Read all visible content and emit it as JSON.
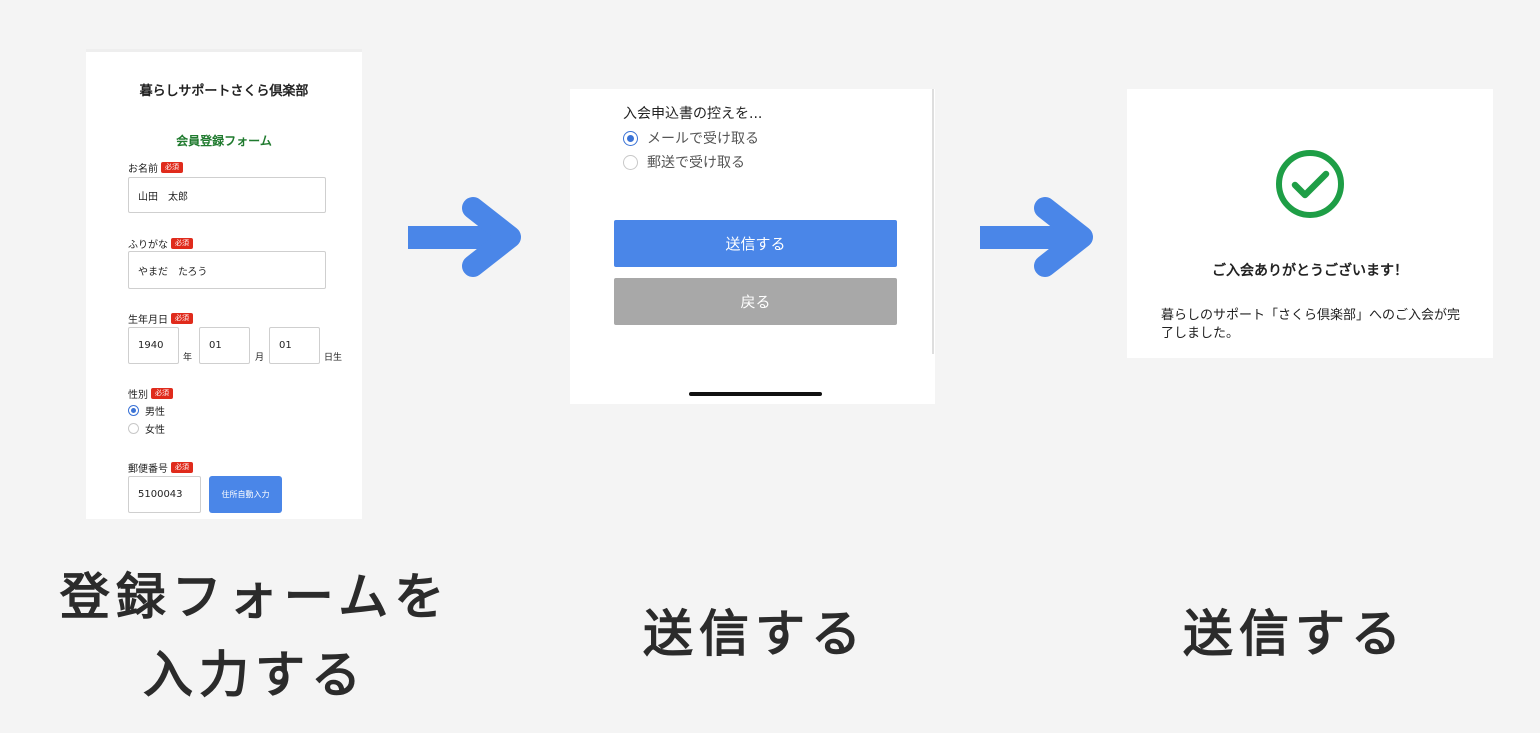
{
  "form": {
    "title": "暮らしサポートさくら倶楽部",
    "subtitle": "会員登録フォーム",
    "required_badge": "必須",
    "name": {
      "label": "お名前",
      "value": "山田　太郎"
    },
    "kana": {
      "label": "ふりがな",
      "value": "やまだ　たろう"
    },
    "birth": {
      "label": "生年月日",
      "year": "1940",
      "year_unit": "年",
      "month": "01",
      "month_unit": "月",
      "day": "01",
      "day_unit": "日生"
    },
    "gender": {
      "label": "性別",
      "options": [
        {
          "label": "男性",
          "selected": true
        },
        {
          "label": "女性",
          "selected": false
        }
      ]
    },
    "postal": {
      "label": "郵便番号",
      "value": "5100043",
      "auto_button": "住所自動入力"
    }
  },
  "submit_screen": {
    "question": "入会申込書の控えを...",
    "options": [
      {
        "label": "メールで受け取る",
        "selected": true
      },
      {
        "label": "郵送で受け取る",
        "selected": false
      }
    ],
    "send_button": "送信する",
    "back_button": "戻る"
  },
  "complete_screen": {
    "thanks": "ご入会ありがとうございます！",
    "message": "暮らしのサポート「さくら倶楽部」へのご入会が完了しました。"
  },
  "captions": {
    "step1_line1": "登録フォームを",
    "step1_line2": "入力する",
    "step2": "送信する",
    "step3": "送信する"
  },
  "colors": {
    "background": "#f4f4f4",
    "accent_blue": "#4a86e8",
    "required_red": "#e02b1c",
    "subtitle_green": "#1f7a2e",
    "back_gray": "#a8a8a8",
    "check_green": "#1e9e46"
  },
  "icons": {
    "arrow": "arrow-right-icon",
    "check": "check-circle-icon"
  }
}
